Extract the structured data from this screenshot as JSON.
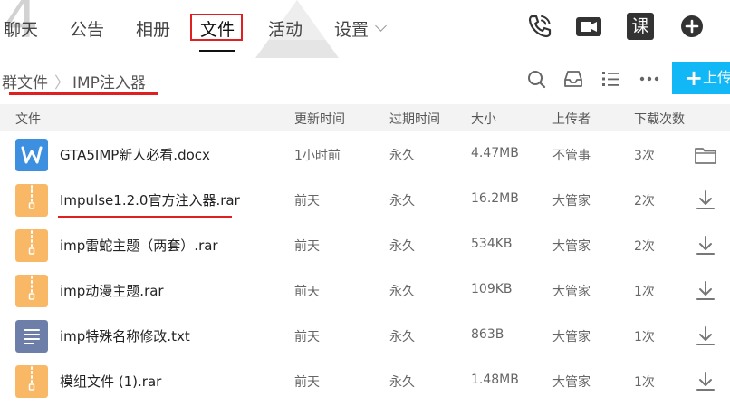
{
  "nav": {
    "tabs": [
      {
        "label": "聊天"
      },
      {
        "label": "公告"
      },
      {
        "label": "相册"
      },
      {
        "label": "文件"
      },
      {
        "label": "活动"
      },
      {
        "label": "设置"
      }
    ],
    "active_tab": "文件",
    "icons": [
      "phone-icon",
      "video-call-icon",
      "course-icon",
      "add-icon"
    ],
    "course_label": "课"
  },
  "breadcrumb": {
    "root": "群文件",
    "separator": "〉",
    "current": "IMP注入器"
  },
  "toolbar": {
    "icons": [
      "search-icon",
      "inbox-icon",
      "list-view-icon",
      "more-icon"
    ],
    "upload_label": "上传"
  },
  "table": {
    "headers": [
      "文件",
      "更新时间",
      "过期时间",
      "大小",
      "上传者",
      "下载次数"
    ],
    "rows": [
      {
        "name": "GTA5IMP新人必看.docx",
        "updated": "1小时前",
        "expire": "永久",
        "size": "4.47MB",
        "uploader": "不管事",
        "downloads": "3次",
        "type": "word",
        "action": "folder-icon"
      },
      {
        "name": "Impulse1.2.0官方注入器.rar",
        "updated": "前天",
        "expire": "永久",
        "size": "16.2MB",
        "uploader": "大管家",
        "downloads": "2次",
        "type": "archive",
        "action": "download-icon"
      },
      {
        "name": "imp雷蛇主题（两套）.rar",
        "updated": "前天",
        "expire": "永久",
        "size": "534KB",
        "uploader": "大管家",
        "downloads": "2次",
        "type": "archive",
        "action": "download-icon"
      },
      {
        "name": "imp动漫主题.rar",
        "updated": "前天",
        "expire": "永久",
        "size": "109KB",
        "uploader": "大管家",
        "downloads": "1次",
        "type": "archive",
        "action": "download-icon"
      },
      {
        "name": "imp特殊名称修改.txt",
        "updated": "前天",
        "expire": "永久",
        "size": "863B",
        "uploader": "大管家",
        "downloads": "1次",
        "type": "text",
        "action": "download-icon"
      },
      {
        "name": "模组文件 (1).rar",
        "updated": "前天",
        "expire": "永久",
        "size": "1.48MB",
        "uploader": "大管家",
        "downloads": "1次",
        "type": "archive",
        "action": "download-icon"
      }
    ]
  },
  "colors": {
    "accent": "#12b7f5",
    "highlight": "#e02020",
    "archive": "#f8b865",
    "word": "#3d8fe0",
    "text_file": "#6d7fa8"
  }
}
